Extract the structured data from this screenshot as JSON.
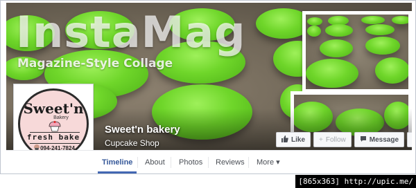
{
  "cover": {
    "title": "InstaMag",
    "subtitle": "Magazine-Style Collage"
  },
  "page": {
    "name": "Sweet'n bakery",
    "category": "Cupcake Shop"
  },
  "logo": {
    "brand": "Sweet'n",
    "bakery_word": "Bakery",
    "tagline": "fresh bake",
    "phone": "094-241-7824",
    "bg_color": "#f7d9d9"
  },
  "actions": {
    "like": {
      "label": "Like",
      "icon": "thumbs-up-icon"
    },
    "follow": {
      "label": "Follow",
      "icon": "plus-icon"
    },
    "message": {
      "label": "Message",
      "icon": "chat-bubble-icon"
    },
    "more": {
      "label": "•••",
      "icon": "more-dots-icon"
    }
  },
  "tabs": [
    {
      "label": "Timeline",
      "active": true
    },
    {
      "label": "About"
    },
    {
      "label": "Photos"
    },
    {
      "label": "Reviews"
    },
    {
      "label": "More ▾"
    }
  ],
  "watermark": "[865x363] http://upic.me/",
  "colors": {
    "accent": "#4267b2",
    "tab_active_text": "#365899",
    "macaron_green": "#6fd62a",
    "tray_brown": "#6e6556"
  }
}
